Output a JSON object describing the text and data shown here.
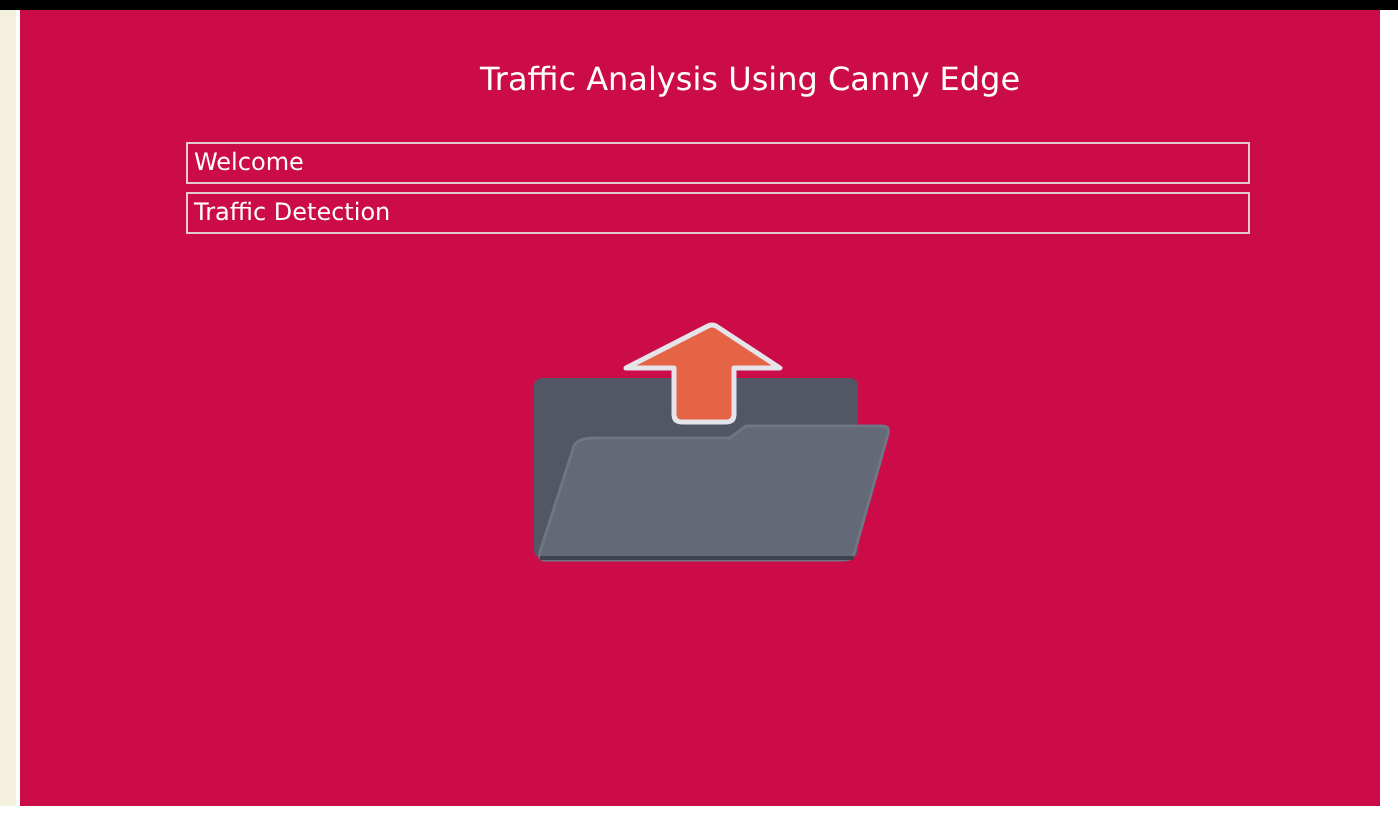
{
  "title": "Traffic Analysis Using Canny Edge",
  "menu": [
    {
      "label": "Welcome"
    },
    {
      "label": "Traffic Detection"
    }
  ]
}
